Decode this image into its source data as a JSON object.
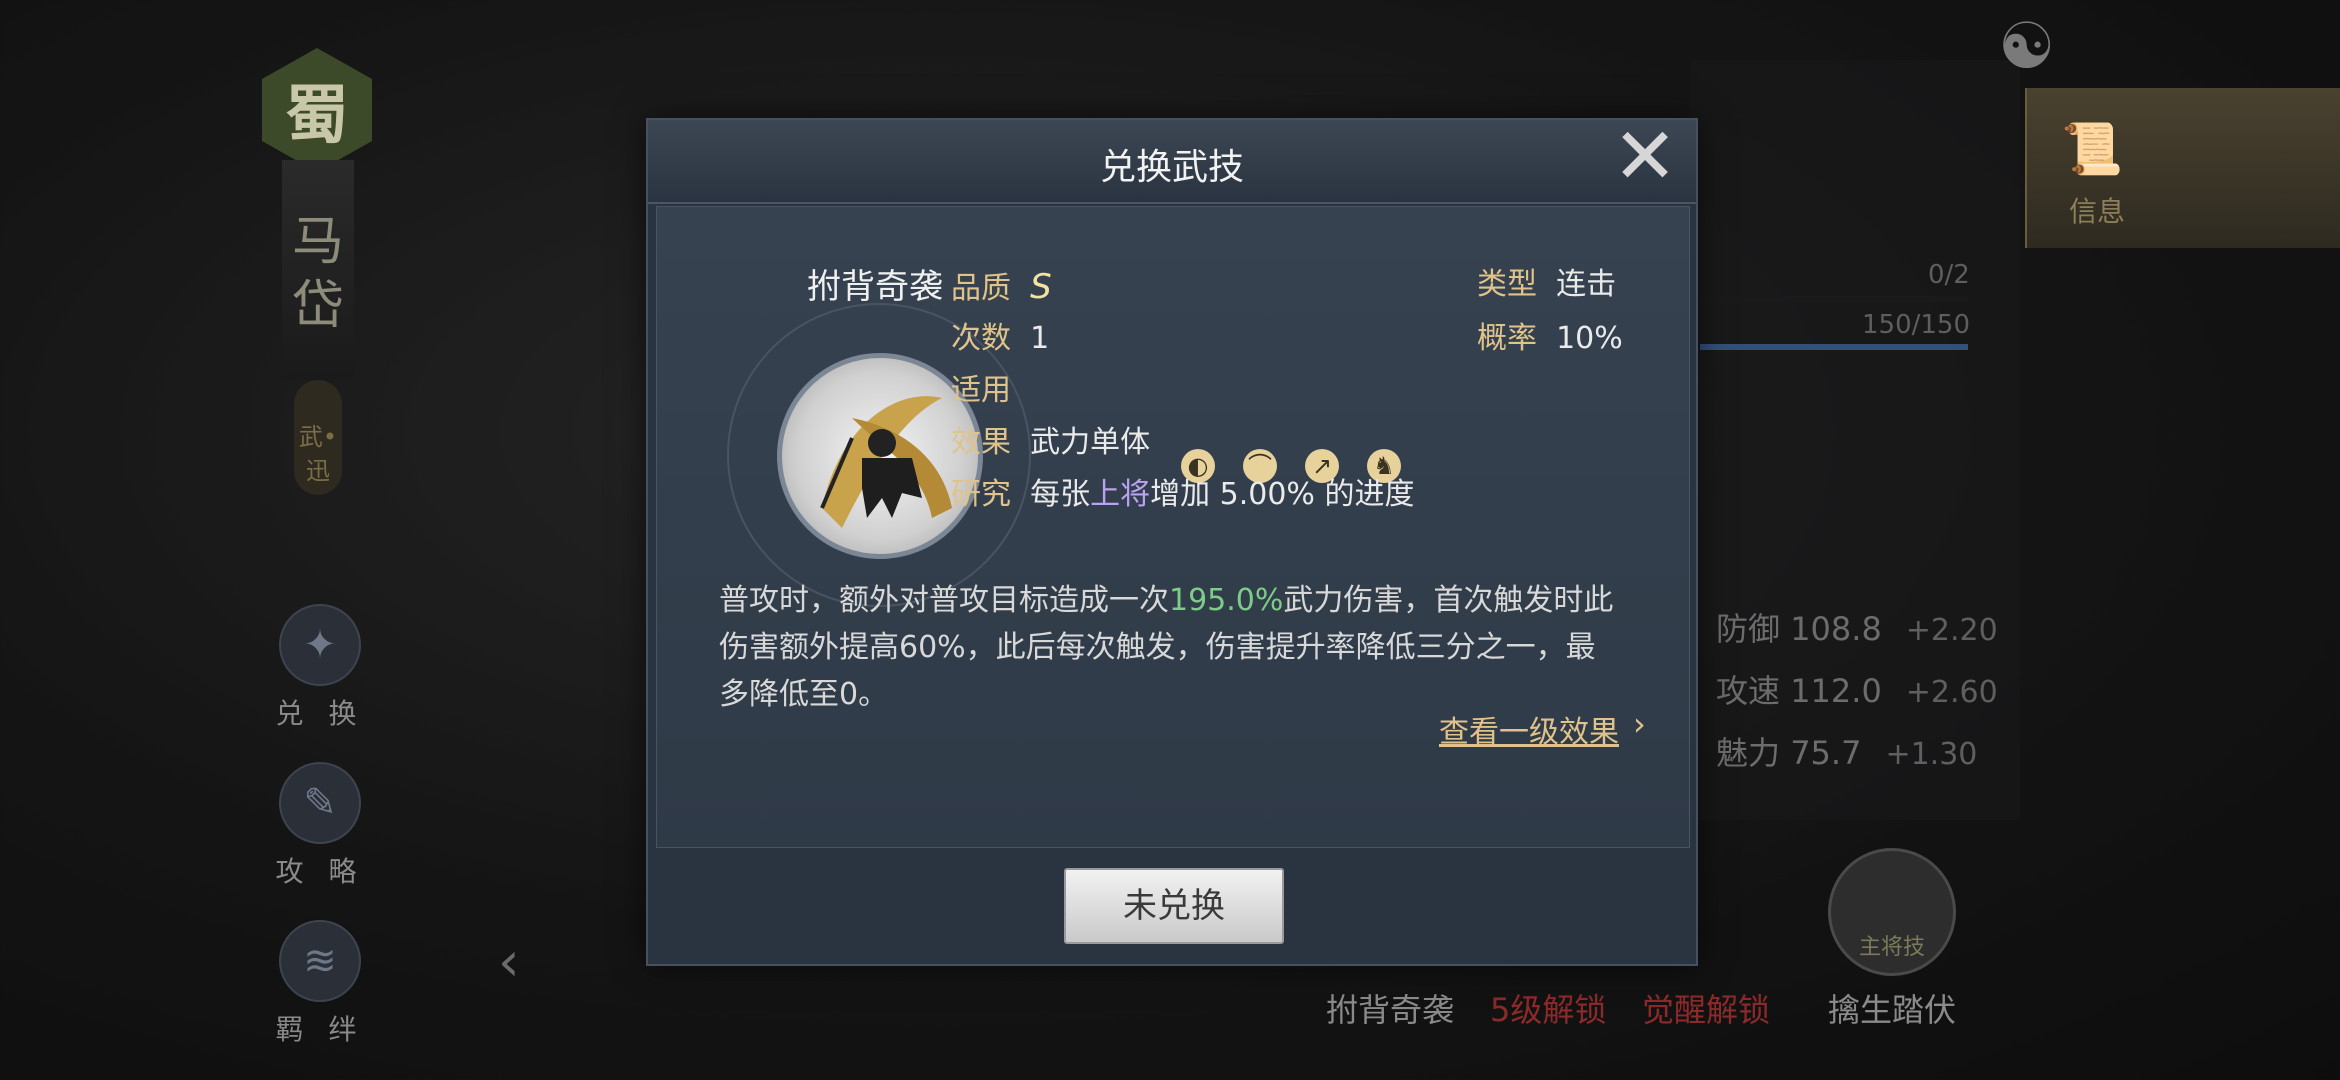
{
  "left": {
    "faction": "蜀",
    "hero_name": "马岱",
    "hero_tag": "武•迅",
    "buttons": [
      {
        "label": "兑 换"
      },
      {
        "label": "攻 略"
      },
      {
        "label": "羁 绊"
      }
    ]
  },
  "right": {
    "info_tab": "信息",
    "counter1": "0/2",
    "counter2": "150/150",
    "attributes": [
      {
        "name": "防御",
        "value": "108.8",
        "delta": "+2.20"
      },
      {
        "name": "攻速",
        "value": "112.0",
        "delta": "+2.60"
      },
      {
        "name": "魅力",
        "value": "75.7",
        "delta": "+1.30"
      }
    ],
    "skills": [
      {
        "label": "拊背奇袭",
        "color": "#8a8a8a"
      },
      {
        "label": "5级解锁",
        "color": "#8c2a2a"
      },
      {
        "label": "觉醒解锁",
        "color": "#8c2a2a"
      },
      {
        "label": "擒生踏伏",
        "color": "#8a8a8a",
        "badge": "主将技"
      }
    ]
  },
  "dialog": {
    "title": "兑换武技",
    "skill_name": "拊背奇袭",
    "quality_key": "品质",
    "quality_value": "S",
    "type_key": "类型",
    "type_value": "连击",
    "count_key": "次数",
    "count_value": "1",
    "rate_key": "概率",
    "rate_value": "10%",
    "apply_key": "适用",
    "apply_icons": [
      "shield-icon",
      "bow-icon",
      "spear-icon",
      "horse-icon"
    ],
    "effect_key": "效果",
    "effect_value": "武力单体",
    "research_key": "研究",
    "research_prefix": "每张",
    "research_highlight": "上将",
    "research_suffix": "增加 5.00% 的进度",
    "desc_part1": "普攻时，额外对普攻目标造成一次",
    "desc_highlight": "195.0%",
    "desc_part2": "武力伤害，首次触发时此伤害额外提高60%，此后每次触发，伤害提升率降低三分之一，最多降低至0。",
    "link_text": "查看一级效果",
    "button_label": "未兑换",
    "colors": {
      "highlight_green": "#7dcc88",
      "highlight_purple": "#b9a2f0",
      "key_gold": "#e0c38a"
    }
  }
}
